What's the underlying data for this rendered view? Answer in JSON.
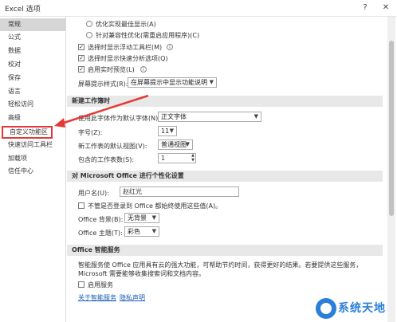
{
  "window": {
    "title": "Excel 选项",
    "help": "?",
    "close": "✕"
  },
  "sidebar": {
    "items": [
      {
        "label": "常规"
      },
      {
        "label": "公式"
      },
      {
        "label": "数据"
      },
      {
        "label": "校对"
      },
      {
        "label": "保存"
      },
      {
        "label": "语言"
      },
      {
        "label": "轻松访问"
      },
      {
        "label": "高级"
      },
      {
        "label": "自定义功能区"
      },
      {
        "label": "快速访问工具栏"
      },
      {
        "label": "加载项"
      },
      {
        "label": "信任中心"
      }
    ]
  },
  "ui_options": {
    "radio1": "优化实现最佳显示(A)",
    "radio2": "针对兼容性优化(需重启应用程序)(C)",
    "check1": "选择时显示浮动工具栏(M)",
    "check2": "选择时显示快速分析选项(Q)",
    "check3": "启用实时预览(L)",
    "tooltip_label": "屏幕提示样式(R):",
    "tooltip_value": "在屏幕提示中显示功能说明"
  },
  "new_workbook": {
    "header": "新建工作簿时",
    "font_label": "使用此字体作为默认字体(N):",
    "font_value": "正文字体",
    "size_label": "字号(Z):",
    "size_value": "11",
    "view_label": "新工作表的默认视图(V):",
    "view_value": "普通视图",
    "sheets_label": "包含的工作表数(S):",
    "sheets_value": "1"
  },
  "personalize": {
    "header": "对 Microsoft Office 进行个性化设置",
    "username_label": "用户名(U):",
    "username_value": "赵红光",
    "always_use_label": "不管是否登录到 Office 都始终使用这些值(A)。",
    "background_label": "Office 背景(B):",
    "background_value": "无背景",
    "theme_label": "Office 主题(T):",
    "theme_value": "彩色"
  },
  "intelligent": {
    "header": "Office 智能服务",
    "description": "智能服务使 Office 应用具有云的强大功能，可帮助节约时间，获得更好的结果。若要提供这些服务，Microsoft 需要能够收集搜索词和文档内容。",
    "enable_label": "启用服务",
    "about_link": "关于智能服务",
    "privacy_link": "隐私声明"
  },
  "watermark": {
    "text": "系统天地"
  }
}
